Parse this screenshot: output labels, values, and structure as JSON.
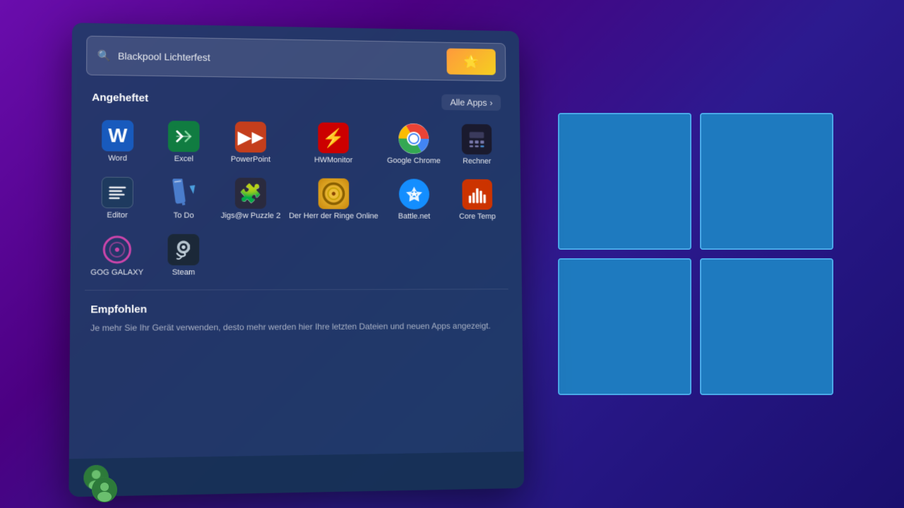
{
  "background": {
    "gradient": "purple to blue"
  },
  "windows_logo": {
    "tiles": [
      "top-left",
      "top-right",
      "bottom-left",
      "bottom-right"
    ]
  },
  "start_menu": {
    "search": {
      "placeholder": "Blackpool Lichterfest",
      "value": "Blackpool Lichterfest"
    },
    "pinned_section": {
      "title": "Angeheftet",
      "alle_apps_label": "Alle Apps",
      "alle_apps_arrow": "›"
    },
    "apps": [
      {
        "id": "word",
        "label": "Word",
        "icon_type": "word"
      },
      {
        "id": "excel",
        "label": "Excel",
        "icon_type": "excel"
      },
      {
        "id": "powerpoint",
        "label": "PowerPoint",
        "icon_type": "ppt"
      },
      {
        "id": "hwmonitor",
        "label": "HWMonitor",
        "icon_type": "hw"
      },
      {
        "id": "chrome",
        "label": "Google Chrome",
        "icon_type": "chrome"
      },
      {
        "id": "rechner",
        "label": "Rechner",
        "icon_type": "rechner"
      },
      {
        "id": "editor",
        "label": "Editor",
        "icon_type": "editor"
      },
      {
        "id": "todo",
        "label": "To Do",
        "icon_type": "todo"
      },
      {
        "id": "jigsaw",
        "label": "Jigs@w Puzzle 2",
        "icon_type": "jigsaw"
      },
      {
        "id": "herr",
        "label": "Der Herr der Ringe Online",
        "icon_type": "herr"
      },
      {
        "id": "battlenet",
        "label": "Battle.net",
        "icon_type": "battlenet"
      },
      {
        "id": "coretemp",
        "label": "Core Temp",
        "icon_type": "coretemp"
      },
      {
        "id": "gog",
        "label": "GOG GALAXY",
        "icon_type": "gog"
      },
      {
        "id": "steam",
        "label": "Steam",
        "icon_type": "steam"
      }
    ],
    "empfohlen": {
      "title": "Empfohlen",
      "description": "Je mehr Sie Ihr Gerät verwenden, desto mehr werden hier Ihre letzten Dateien und neuen Apps angezeigt."
    }
  }
}
